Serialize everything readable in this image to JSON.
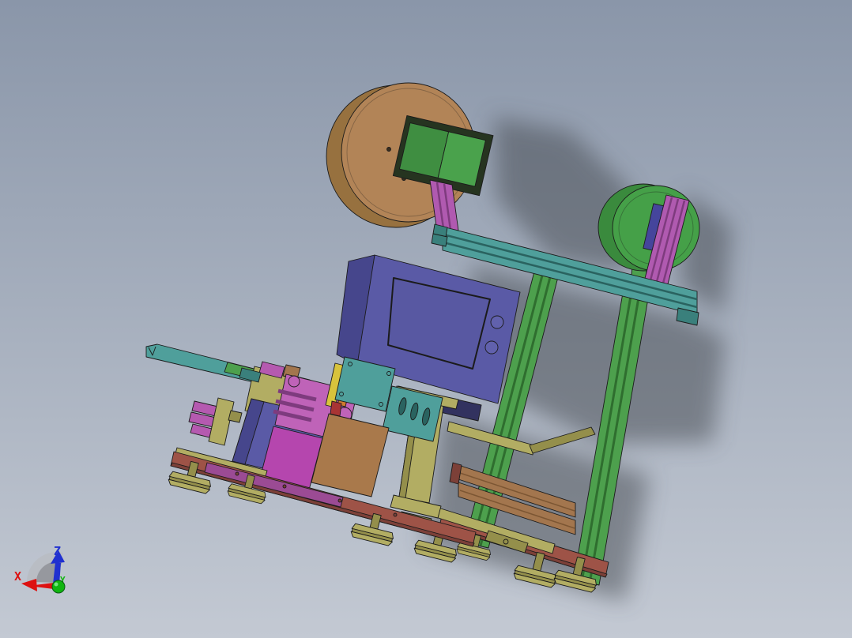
{
  "viewport": {
    "description": "CAD 3D viewport showing a tape-feeder machine assembly with reel, frame and base",
    "palette": {
      "outline": "#1b1b1b",
      "bg_top": "#8a96a9",
      "bg_bottom": "#c3c9d3",
      "shadow": "#43474e",
      "reel_brown": "#b28457",
      "reel_brown_dark": "#97713f",
      "hub_red": "#9f4f45",
      "hole_dark": "#3a2e1e",
      "motor_green": "#4aa24c",
      "motor_green_dark": "#3f8e41",
      "bracket_dark": "#263420",
      "magenta": "#b05ab0",
      "magenta_dark": "#7e3b7e",
      "magenta_light": "#c985c9",
      "teal": "#4f9f9b",
      "teal_dark": "#3a807c",
      "teal_darker": "#2a6360",
      "frame_green": "#4da04d",
      "frame_green_dark": "#2f6e2f",
      "disc_green": "#45a048",
      "disc_green_dark": "#3a8a3d",
      "plate_blue": "#45459c",
      "box_purple": "#5a5aa6",
      "box_purple_dark": "#46468c",
      "screen_purple": "#5858a2",
      "screen_edge": "#26264e",
      "button_purple": "#6161ad",
      "bracket_navy": "#32325f",
      "khaki": "#b2ad63",
      "khaki_dark": "#948f4b",
      "base_red": "#9e5347",
      "base_red_dark": "#7c4038",
      "wood_brown": "#a3764e",
      "wood_brown_dark": "#7c5633",
      "table_brown": "#a9794b",
      "gripper_pink": "#bf63b8",
      "finger_pink": "#b55ab0",
      "violet": "#b546ae",
      "purple_strip": "#9b4b94",
      "yellow": "#d8c33c",
      "orange": "#cf7a2e",
      "accent_red": "#a83434",
      "triad_fan_light": "#b9bcc2",
      "triad_fan_dark": "#8f9298"
    }
  },
  "triad": {
    "x": {
      "label": "X",
      "color": "#dd1111"
    },
    "y": {
      "label": "Y",
      "color": "#10b510"
    },
    "z": {
      "label": "Z",
      "color": "#2030d0"
    }
  }
}
